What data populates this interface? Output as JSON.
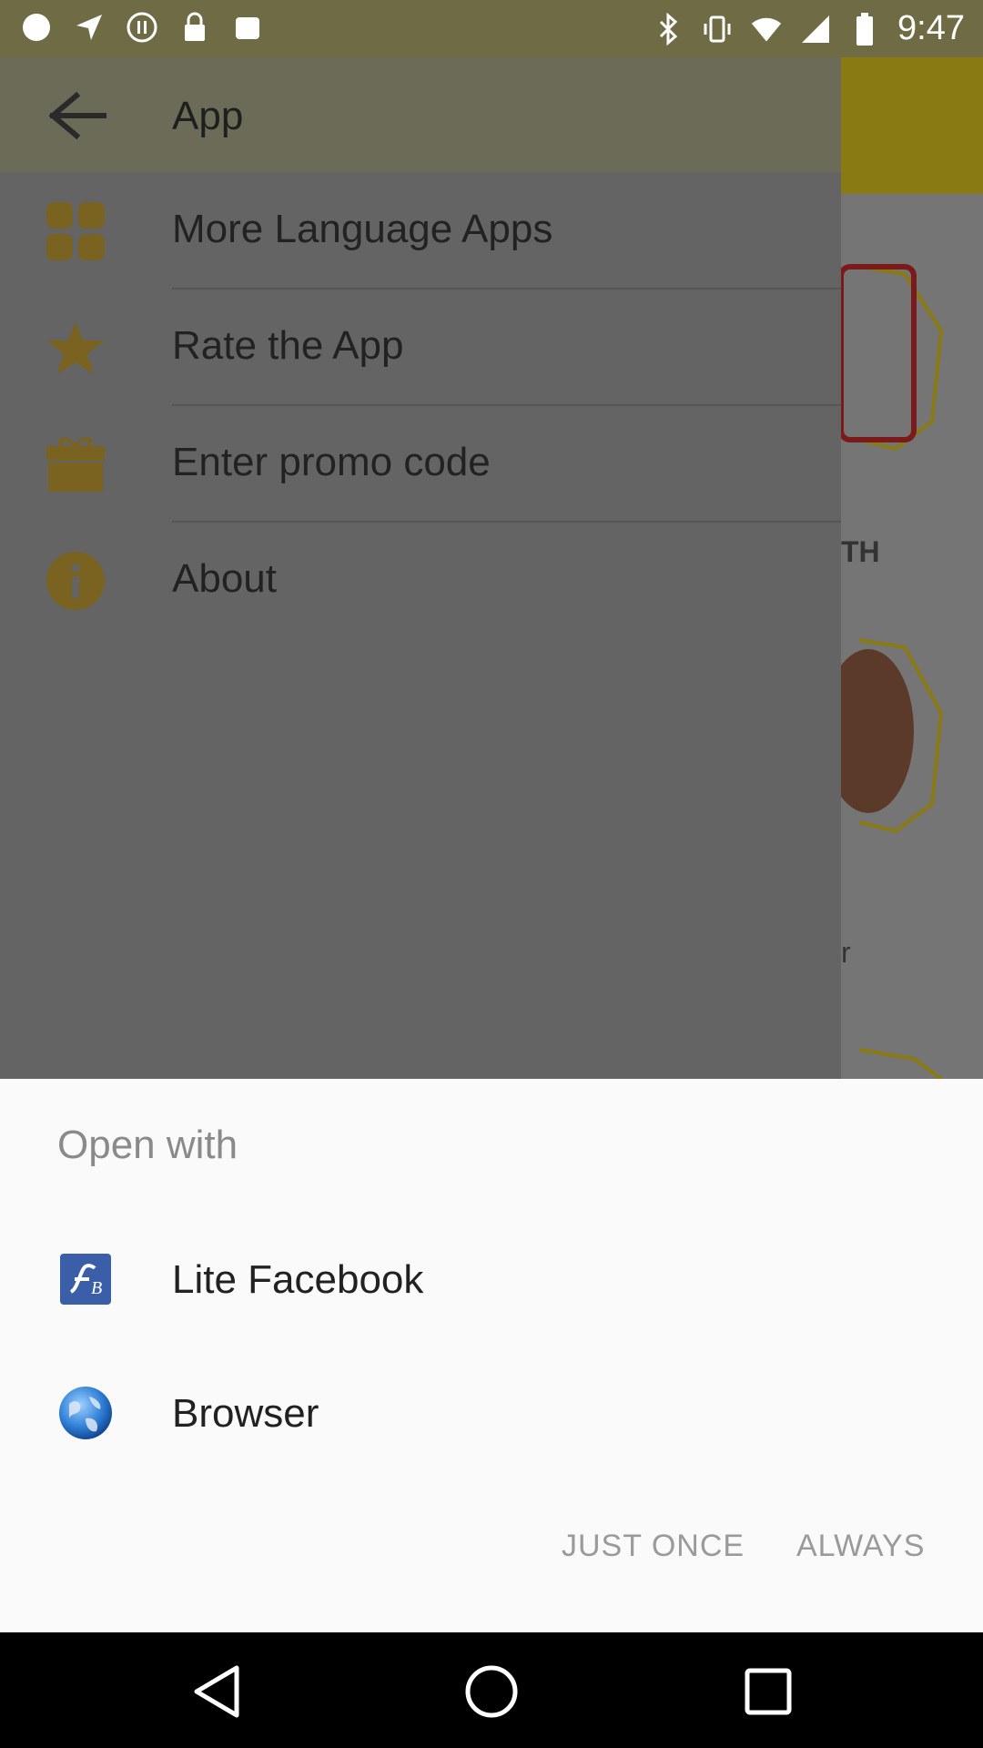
{
  "status_bar": {
    "time": "9:47",
    "left_icons": [
      "notification-dot-icon",
      "fake-gps-icon",
      "pause-icon",
      "lock-icon",
      "clipboard-icon"
    ],
    "right_icons": [
      "bluetooth-icon",
      "vibrate-icon",
      "wifi-icon",
      "signal-icon",
      "battery-icon"
    ]
  },
  "drawer": {
    "title": "App",
    "items": [
      {
        "label": "More Language Apps",
        "icon": "grid-apps-icon"
      },
      {
        "label": "Rate the App",
        "icon": "star-icon"
      },
      {
        "label": "Enter promo code",
        "icon": "gift-icon"
      },
      {
        "label": "About",
        "icon": "info-icon"
      }
    ],
    "accent_color": "#e2a80e"
  },
  "background_app": {
    "partial_text_1": "TH",
    "partial_text_2": "r"
  },
  "chooser": {
    "title": "Open with",
    "options": [
      {
        "label": "Lite Facebook",
        "icon": "lite-facebook-icon"
      },
      {
        "label": "Browser",
        "icon": "browser-globe-icon"
      }
    ],
    "just_once_label": "JUST ONCE",
    "always_label": "ALWAYS"
  },
  "nav_bar": {
    "buttons": [
      "back-nav-icon",
      "home-nav-icon",
      "recents-nav-icon"
    ]
  }
}
